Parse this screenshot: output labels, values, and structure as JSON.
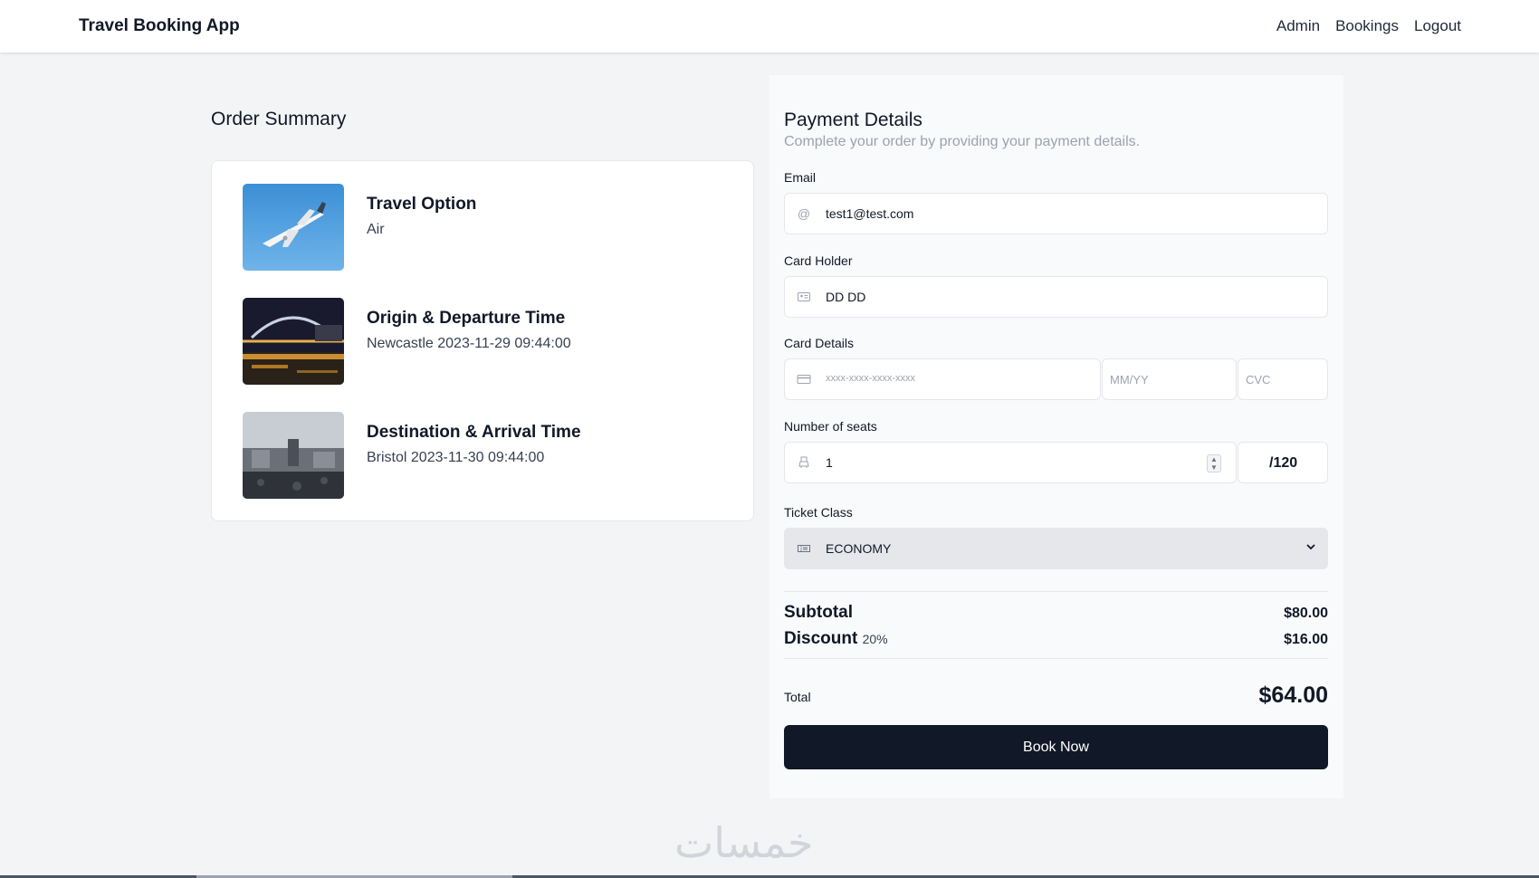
{
  "navbar": {
    "brand": "Travel Booking App",
    "links": [
      "Admin",
      "Bookings",
      "Logout"
    ]
  },
  "order_summary": {
    "title": "Order Summary",
    "items": [
      {
        "title": "Travel Option",
        "value": "Air",
        "image": "airplane-photo"
      },
      {
        "title": "Origin & Departure Time",
        "value": "Newcastle 2023-11-29 09:44:00",
        "image": "newcastle-bridge-night-photo"
      },
      {
        "title": "Destination & Arrival Time",
        "value": "Bristol 2023-11-30 09:44:00",
        "image": "bristol-city-photo"
      }
    ]
  },
  "payment": {
    "title": "Payment Details",
    "subtitle": "Complete your order by providing your payment details.",
    "email": {
      "label": "Email",
      "value": "test1@test.com",
      "icon": "at-icon"
    },
    "card_holder": {
      "label": "Card Holder",
      "value": "DD DD",
      "icon": "id-card-icon"
    },
    "card_details": {
      "label": "Card Details",
      "number_placeholder": "xxxx-xxxx-xxxx-xxxx",
      "expiry_placeholder": "MM/YY",
      "cvc_placeholder": "CVC",
      "icon": "credit-card-icon"
    },
    "seats": {
      "label": "Number of seats",
      "value": "1",
      "max": "/120",
      "icon": "seat-icon"
    },
    "ticket_class": {
      "label": "Ticket Class",
      "value": "ECONOMY",
      "icon": "ticket-icon"
    },
    "summary": {
      "subtotal_label": "Subtotal",
      "subtotal_value": "$80.00",
      "discount_label": "Discount",
      "discount_pct": "20%",
      "discount_value": "$16.00",
      "total_label": "Total",
      "total_value": "$64.00"
    },
    "book_button": "Book Now"
  },
  "watermark": "خمسات",
  "colors": {
    "page_bg": "#f3f4f6",
    "button_bg": "#111827",
    "muted_text": "#9ca3af"
  }
}
